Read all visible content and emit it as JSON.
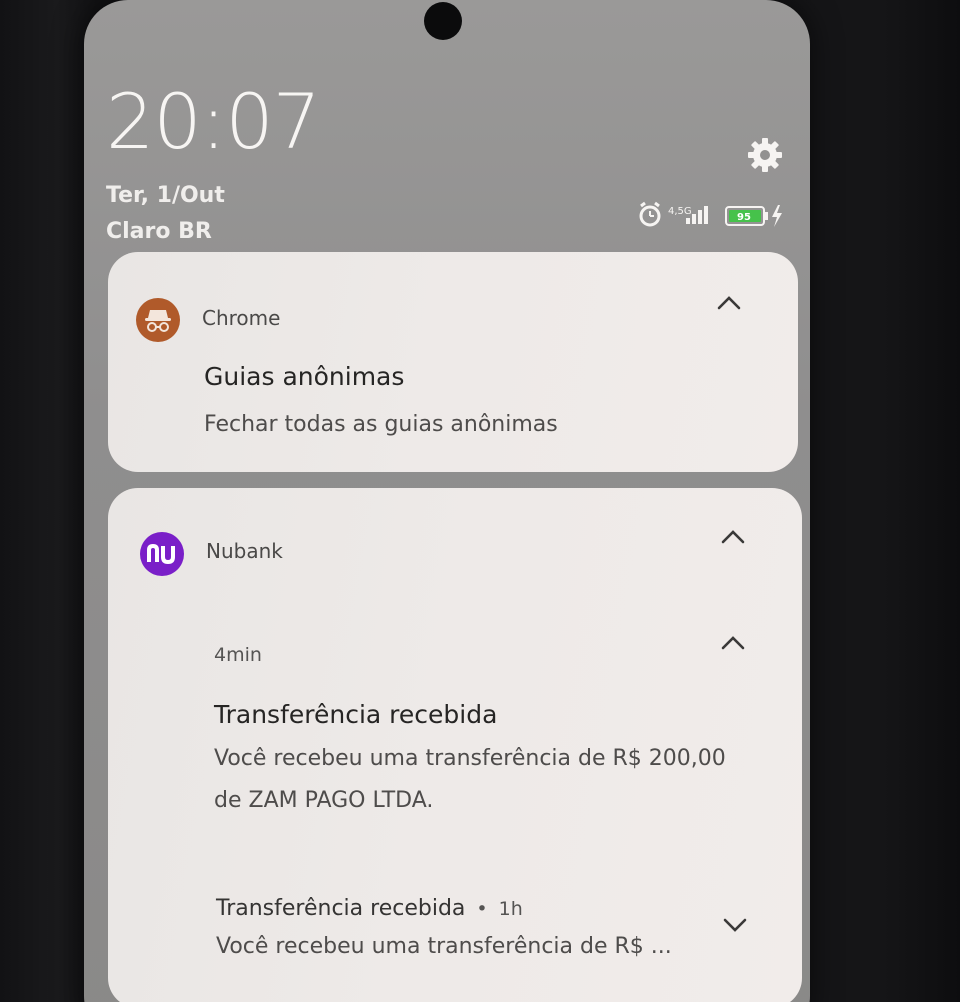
{
  "lockscreen": {
    "time": "20:07",
    "date": "Ter, 1/Out",
    "carrier": "Claro BR",
    "network_type": "4,5G",
    "battery_level": "95",
    "icons": [
      "settings-icon",
      "alarm-icon",
      "signal-icon",
      "battery-icon",
      "charging-icon"
    ]
  },
  "notifications": {
    "chrome": {
      "app_name": "Chrome",
      "icon": "incognito-icon",
      "icon_color": "#b05a2a",
      "title": "Guias anônimas",
      "body": "Fechar todas as guias anônimas"
    },
    "nubank": {
      "app_name": "Nubank",
      "icon": "nubank-logo-icon",
      "icon_color": "#7a1fc8",
      "expanded": {
        "time": "4min",
        "title": "Transferência recebida",
        "body_line1": "Você recebeu uma transferência de R$ 200,00",
        "body_line2": "de ZAM PAGO LTDA."
      },
      "collapsed": {
        "title": "Transferência recebida",
        "separator": "•",
        "time": "1h",
        "body": "Você recebeu uma transferência de R$ ..."
      }
    }
  }
}
